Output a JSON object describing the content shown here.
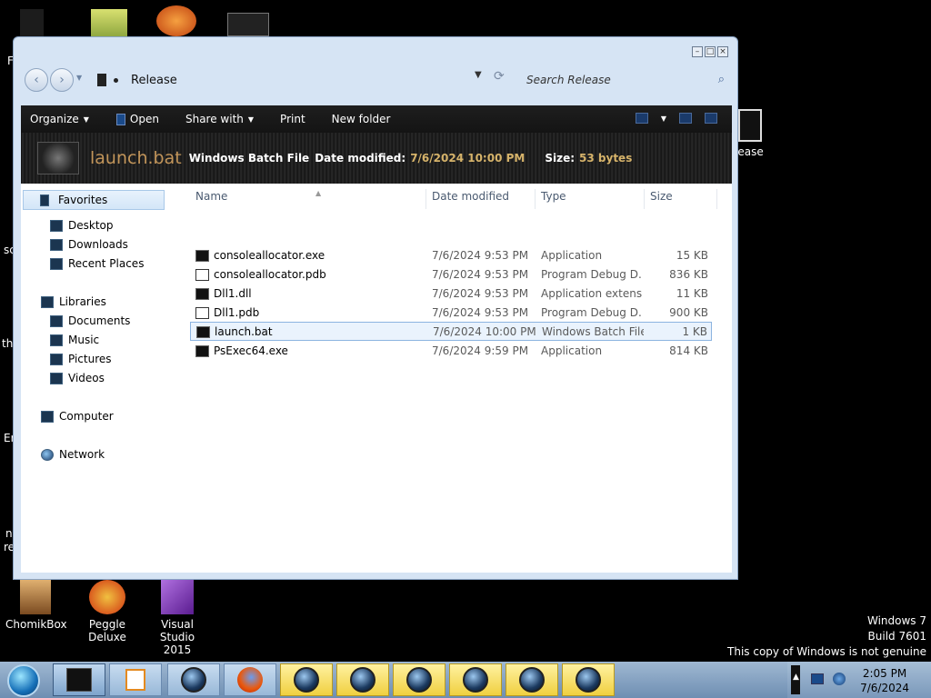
{
  "desktop": {
    "icons": [
      {
        "label": "ChomikBox"
      },
      {
        "label": "Peggle Deluxe"
      },
      {
        "label": "Visual Studio 2015"
      },
      {
        "label": "lease"
      }
    ],
    "partial_labels": [
      "F",
      "sc",
      "th",
      "Er",
      "n",
      "re"
    ],
    "watermark": {
      "line1": "Windows 7",
      "line2": "Build 7601",
      "line3": "This copy of Windows is not genuine"
    }
  },
  "window": {
    "address": {
      "path": "Release"
    },
    "search": {
      "placeholder": "Search Release"
    },
    "toolbar": {
      "organize": "Organize",
      "open": "Open",
      "share_with": "Share with",
      "print": "Print",
      "new_folder": "New folder"
    },
    "details": {
      "name": "launch.bat",
      "type": "Windows Batch File",
      "date_label": "Date modified:",
      "date_value": "7/6/2024 10:00 PM",
      "size_label": "Size:",
      "size_value": "53 bytes"
    },
    "nav": {
      "favorites": "Favorites",
      "desktop": "Desktop",
      "downloads": "Downloads",
      "recent_places": "Recent Places",
      "libraries": "Libraries",
      "documents": "Documents",
      "music": "Music",
      "pictures": "Pictures",
      "videos": "Videos",
      "computer": "Computer",
      "network": "Network"
    },
    "columns": {
      "name": "Name",
      "date_modified": "Date modified",
      "type": "Type",
      "size": "Size"
    },
    "files": [
      {
        "name": "consoleallocator.exe",
        "date": "7/6/2024 9:53 PM",
        "type": "Application",
        "size": "15 KB"
      },
      {
        "name": "consoleallocator.pdb",
        "date": "7/6/2024 9:53 PM",
        "type": "Program Debug D...",
        "size": "836 KB"
      },
      {
        "name": "Dll1.dll",
        "date": "7/6/2024 9:53 PM",
        "type": "Application extens...",
        "size": "11 KB"
      },
      {
        "name": "Dll1.pdb",
        "date": "7/6/2024 9:53 PM",
        "type": "Program Debug D...",
        "size": "900 KB"
      },
      {
        "name": "launch.bat",
        "date": "7/6/2024 10:00 PM",
        "type": "Windows Batch File",
        "size": "1 KB"
      },
      {
        "name": "PsExec64.exe",
        "date": "7/6/2024 9:59 PM",
        "type": "Application",
        "size": "814 KB"
      }
    ]
  },
  "taskbar": {
    "clock": {
      "time": "2:05 PM",
      "date": "7/6/2024"
    }
  }
}
